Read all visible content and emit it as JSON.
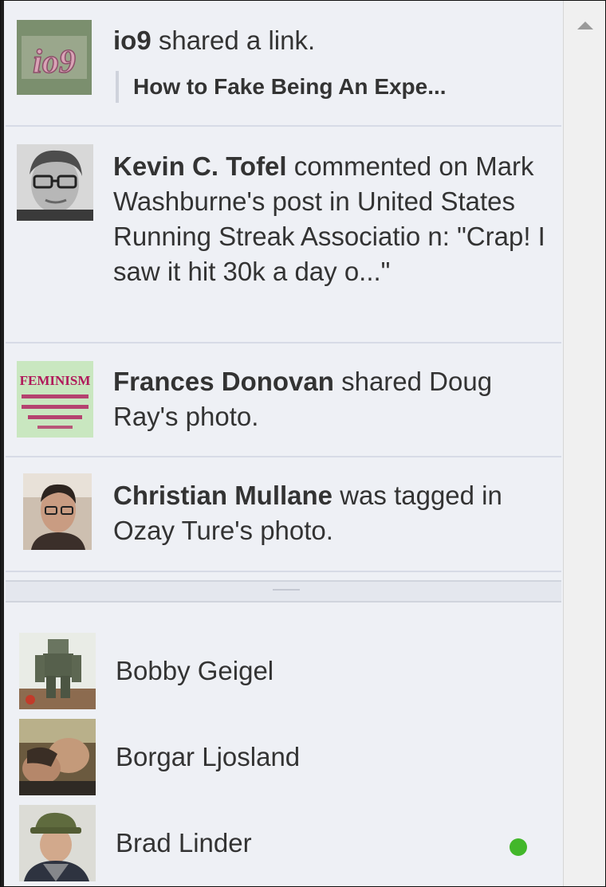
{
  "ticker": {
    "stories": [
      {
        "actor": "io9",
        "action": " shared a link.",
        "attachment": "How to Fake Being An Expe...",
        "avatar_icon": "io9-logo-icon",
        "avatar_text": "io9"
      },
      {
        "actor": "Kevin C. Tofel",
        "action": " commented on Mark Washburne's post in United States Running Streak Associatio n: \"Crap! I saw it hit 30k a day o...\"",
        "avatar_icon": "kevin-avatar-icon"
      },
      {
        "actor": "Frances Donovan",
        "action": " shared Doug Ray's photo.",
        "avatar_icon": "feminism-poster-icon",
        "avatar_text": "FEMINISM"
      },
      {
        "actor": "Christian Mullane",
        "action": " was tagged in Ozay Ture's photo.",
        "avatar_icon": "christian-avatar-icon"
      }
    ]
  },
  "chat": {
    "friends": [
      {
        "name": "Bobby Geigel",
        "online": false,
        "avatar_icon": "mech-figure-avatar-icon"
      },
      {
        "name": "Borgar Ljosland",
        "online": false,
        "avatar_icon": "borgar-avatar-icon"
      },
      {
        "name": "Brad Linder",
        "online": true,
        "avatar_icon": "brad-avatar-icon"
      }
    ]
  },
  "colors": {
    "panel_bg": "#eef0f5",
    "online": "#42b72a",
    "text": "#333333"
  }
}
